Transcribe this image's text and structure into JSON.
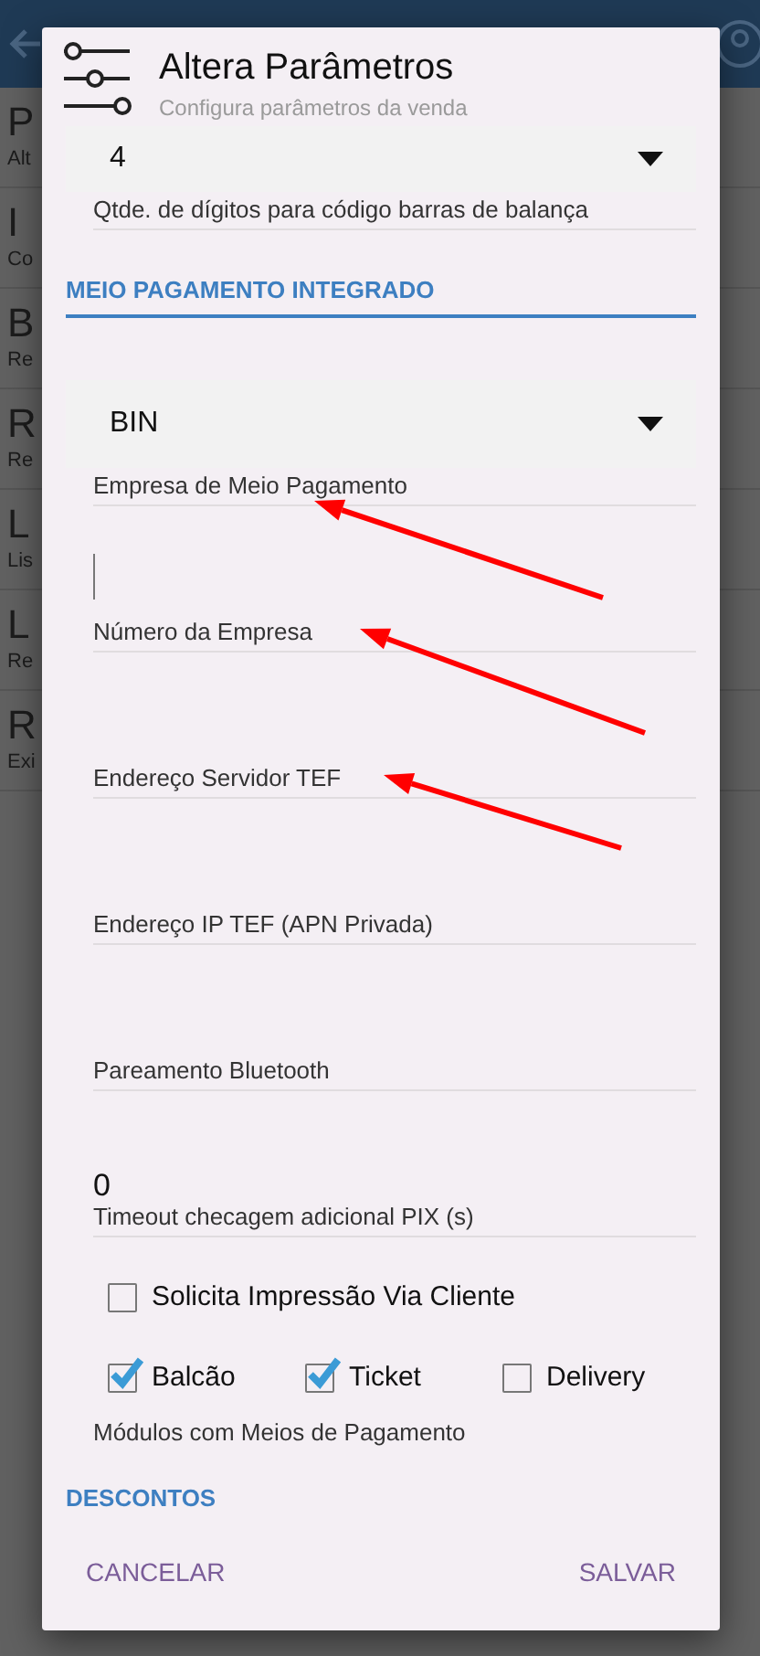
{
  "background_items": [
    {
      "title": "P",
      "subtitle": "Alt"
    },
    {
      "title": "I",
      "subtitle": "Co"
    },
    {
      "title": "B",
      "subtitle": "Re"
    },
    {
      "title": "R",
      "subtitle": "Re"
    },
    {
      "title": "L",
      "subtitle": "Lis"
    },
    {
      "title": "L",
      "subtitle": "Re"
    },
    {
      "title": "R",
      "subtitle": "Exi"
    }
  ],
  "dialog": {
    "title": "Altera Parâmetros",
    "subtitle": "Configura parâmetros da venda",
    "fields": [
      {
        "kind": "select",
        "value": "4",
        "label": "Qtde. de dígitos para código barras de balança",
        "arrow": false
      },
      {
        "kind": "section",
        "label": "MEIO PAGAMENTO INTEGRADO"
      },
      {
        "kind": "select",
        "value": "BIN",
        "label": "Empresa de Meio Pagamento",
        "arrow": true
      },
      {
        "kind": "text",
        "label": "Número da Empresa",
        "focused": true,
        "arrow": true
      },
      {
        "kind": "text",
        "label": "Endereço Servidor TEF",
        "focused": false,
        "arrow": true
      },
      {
        "kind": "text",
        "label": "Endereço IP TEF (APN Privada)",
        "focused": false,
        "arrow": false
      },
      {
        "kind": "text",
        "label": "Pareamento Bluetooth",
        "focused": false,
        "arrow": false
      },
      {
        "kind": "text",
        "value": "0",
        "label": "Timeout checagem adicional PIX (s)",
        "focused": false,
        "arrow": false
      },
      {
        "kind": "checkbox",
        "label": "Solicita Impressão Via Cliente",
        "checked": false
      },
      {
        "kind": "checkgroup",
        "options": [
          {
            "label": "Balcão",
            "checked": true
          },
          {
            "label": "Ticket",
            "checked": true
          },
          {
            "label": "Delivery",
            "checked": false
          }
        ],
        "label": "Módulos com Meios de Pagamento"
      },
      {
        "kind": "section",
        "label": "DESCONTOS"
      }
    ],
    "buttons": [
      "CANCELAR",
      "SALVAR"
    ]
  }
}
